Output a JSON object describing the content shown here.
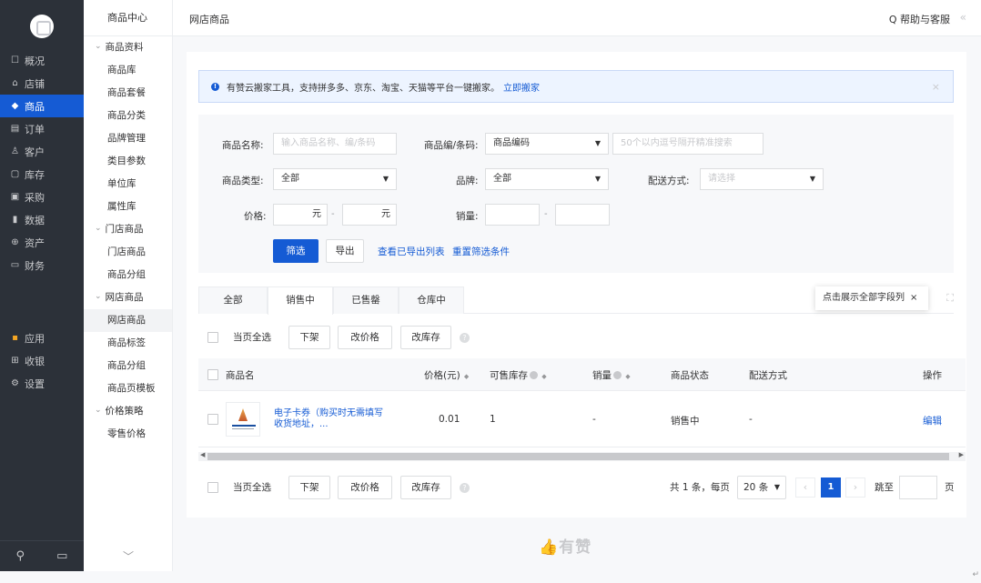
{
  "sidebar_primary": {
    "items": [
      {
        "icon": "chat-icon",
        "glyph": "☐",
        "label": "概况"
      },
      {
        "icon": "store-icon",
        "glyph": "⌂",
        "label": "店铺"
      },
      {
        "icon": "tag-icon",
        "glyph": "◆",
        "label": "商品"
      },
      {
        "icon": "order-icon",
        "glyph": "▤",
        "label": "订单"
      },
      {
        "icon": "customer-icon",
        "glyph": "♙",
        "label": "客户"
      },
      {
        "icon": "inventory-icon",
        "glyph": "▢",
        "label": "库存"
      },
      {
        "icon": "purchase-icon",
        "glyph": "▣",
        "label": "采购"
      },
      {
        "icon": "data-icon",
        "glyph": "▮",
        "label": "数据"
      },
      {
        "icon": "assets-icon",
        "glyph": "⊕",
        "label": "资产"
      },
      {
        "icon": "finance-icon",
        "glyph": "▭",
        "label": "财务"
      }
    ],
    "items2": [
      {
        "icon": "apps-icon",
        "glyph": "▪",
        "label": "应用"
      },
      {
        "icon": "cashier-icon",
        "glyph": "⊞",
        "label": "收银"
      },
      {
        "icon": "settings-icon",
        "glyph": "⚙",
        "label": "设置"
      }
    ]
  },
  "sidebar_secondary": {
    "title": "商品中心",
    "items": [
      {
        "label": "商品资料",
        "group": true
      },
      {
        "label": "商品库"
      },
      {
        "label": "商品套餐"
      },
      {
        "label": "商品分类"
      },
      {
        "label": "品牌管理"
      },
      {
        "label": "类目参数"
      },
      {
        "label": "单位库"
      },
      {
        "label": "属性库"
      },
      {
        "label": "门店商品",
        "group": true
      },
      {
        "label": "门店商品"
      },
      {
        "label": "商品分组"
      },
      {
        "label": "网店商品",
        "group": true
      },
      {
        "label": "网店商品",
        "active": true
      },
      {
        "label": "商品标签"
      },
      {
        "label": "商品分组"
      },
      {
        "label": "商品页模板"
      },
      {
        "label": "价格策略",
        "group": true
      },
      {
        "label": "零售价格"
      }
    ]
  },
  "header": {
    "breadcrumb": "网店商品",
    "help": "Q 帮助与客服",
    "collapse": "«"
  },
  "notice": {
    "text": "有赞云搬家工具，支持拼多多、京东、淘宝、天猫等平台一键搬家。",
    "link": "立即搬家",
    "close": "×"
  },
  "filter": {
    "name_label": "商品名称:",
    "name_placeholder": "输入商品名称、编/条码",
    "code_label": "商品编/条码:",
    "code_select": "商品编码",
    "code_placeholder": "50个以内逗号隔开精准搜索",
    "type_label": "商品类型:",
    "type_value": "全部",
    "brand_label": "品牌:",
    "brand_value": "全部",
    "delivery_label": "配送方式:",
    "delivery_placeholder": "请选择",
    "price_label": "价格:",
    "price_unit": "元",
    "range_sep": "-",
    "sales_label": "销量:",
    "filter_btn": "筛选",
    "export_btn": "导出",
    "view_exports": "查看已导出列表",
    "reset": "重置筛选条件"
  },
  "tabs": {
    "items": [
      "全部",
      "销售中",
      "已售罄",
      "仓库中"
    ],
    "active_index": 1,
    "tip": "点击展示全部字段列",
    "tip_close": "×"
  },
  "batch": {
    "select_page": "当页全选",
    "delist": "下架",
    "change_price": "改价格",
    "change_stock": "改库存"
  },
  "table": {
    "headers": {
      "name": "商品名",
      "price": "价格(元)",
      "stock": "可售库存",
      "sales": "销量",
      "status": "商品状态",
      "delivery": "配送方式",
      "action": "操作"
    },
    "rows": [
      {
        "name": "电子卡券（购买时无需填写收货地址，...",
        "price": "0.01",
        "stock": "1",
        "sales": "-",
        "status": "销售中",
        "delivery": "-",
        "action": "编辑"
      }
    ]
  },
  "pager": {
    "summary": "共 1 条，每页",
    "page_size": "20 条",
    "current": "1",
    "jump": "跳至",
    "page_suffix": "页"
  },
  "footer": {
    "brand": "有赞"
  },
  "colors": {
    "primary": "#155bd4",
    "sidebar_bg": "#2c3139"
  }
}
